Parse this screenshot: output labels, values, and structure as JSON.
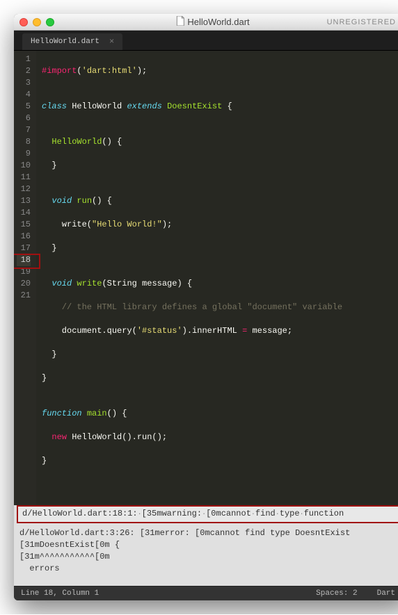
{
  "window": {
    "title": "HelloWorld.dart",
    "registration": "UNREGISTERED"
  },
  "tab": {
    "label": "HelloWorld.dart",
    "close": "×"
  },
  "lines": {
    "count": 21
  },
  "code": {
    "l1a": "#import",
    "l1b": "(",
    "l1c": "'dart:html'",
    "l1d": ");",
    "l2": "",
    "l3a": "class",
    "l3b": " HelloWorld ",
    "l3c": "extends",
    "l3d": " ",
    "l3e": "DoesntExist",
    "l3f": " {",
    "l4": "",
    "l5a": "  ",
    "l5b": "HelloWorld",
    "l5c": "() {",
    "l6": "  }",
    "l7": "",
    "l8a": "  ",
    "l8b": "void",
    "l8c": " ",
    "l8d": "run",
    "l8e": "() {",
    "l9a": "    write(",
    "l9b": "\"Hello World!\"",
    "l9c": ");",
    "l10": "  }",
    "l11": "",
    "l12a": "  ",
    "l12b": "void",
    "l12c": " ",
    "l12d": "write",
    "l12e": "(String message) {",
    "l13": "    // the HTML library defines a global \"document\" variable",
    "l14a": "    document.query(",
    "l14b": "'#status'",
    "l14c": ").innerHTML ",
    "l14d": "=",
    "l14e": " message;",
    "l15": "  }",
    "l16": "}",
    "l17": "",
    "l18a": "function",
    "l18b": " ",
    "l18c": "main",
    "l18d": "() {",
    "l19a": "  ",
    "l19b": "new",
    "l19c": " HelloWorld().run();",
    "l20": "}",
    "l21": ""
  },
  "error_hl": {
    "p1": "d/HelloWorld.dart:18:1:",
    "p2": "[35mwarning:",
    "p3": "[0mcannot",
    "p4": "find",
    "p5": "type",
    "p6": "function"
  },
  "error_rest": "d/HelloWorld.dart:3:26: [31merror: [0mcannot find type DoesntExist\n[31mDoesntExist[0m {\n[31m^^^^^^^^^^^[0m\n  errors",
  "status": {
    "position": "Line 18, Column 1",
    "spaces": "Spaces: 2",
    "syntax": "Dart"
  }
}
